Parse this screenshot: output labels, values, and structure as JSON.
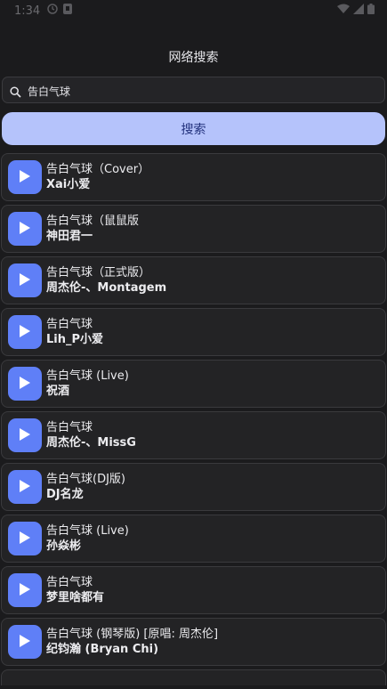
{
  "status_bar": {
    "time": "1:34"
  },
  "page": {
    "title": "网络搜索"
  },
  "search": {
    "value": "告白气球",
    "button_label": "搜索"
  },
  "results": [
    {
      "title": "告白气球（Cover）",
      "artist": "Xai小爱"
    },
    {
      "title": "告白气球（鼠鼠版",
      "artist": "神田君一"
    },
    {
      "title": "告白气球（正式版）",
      "artist": "周杰伦-、Montagem"
    },
    {
      "title": "告白气球",
      "artist": "Lih_P小爱"
    },
    {
      "title": "告白气球 (Live)",
      "artist": "祝酒"
    },
    {
      "title": "告白气球",
      "artist": "周杰伦-、MissG"
    },
    {
      "title": "告白气球(DJ版)",
      "artist": "DJ名龙"
    },
    {
      "title": "告白气球 (Live)",
      "artist": "孙焱彬"
    },
    {
      "title": "告白气球",
      "artist": "梦里啥都有"
    },
    {
      "title": "告白气球 (钢琴版) [原唱: 周杰伦]",
      "artist": "纪钧瀚 (Bryan Chi)"
    }
  ],
  "colors": {
    "background": "#1b1b1d",
    "accent": "#5f7ff7",
    "button_bg": "#b5c3fb",
    "button_text": "#24337e"
  },
  "icons": {
    "play": "play-icon",
    "search": "search-icon",
    "wifi": "wifi-icon",
    "signal": "signal-icon",
    "battery": "battery-icon"
  }
}
